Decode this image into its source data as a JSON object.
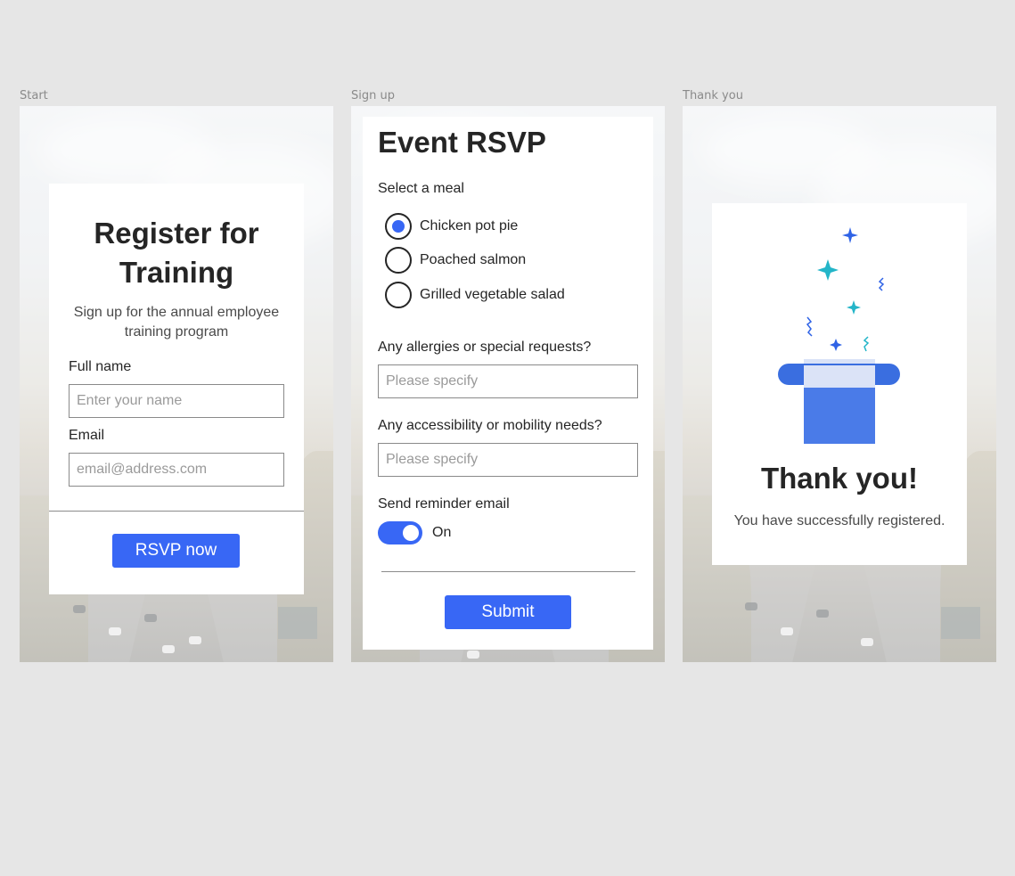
{
  "frames": {
    "start": {
      "label": "Start",
      "title": "Register for Training",
      "subtitle": "Sign up for the annual employee training program",
      "full_name_label": "Full name",
      "full_name_placeholder": "Enter your name",
      "email_label": "Email",
      "email_placeholder": "email@address.com",
      "rsvp_button": "RSVP now"
    },
    "signup": {
      "label": "Sign up",
      "title": "Event RSVP",
      "meal_label": "Select a meal",
      "meal_options": [
        {
          "label": "Chicken pot pie",
          "selected": true
        },
        {
          "label": "Poached salmon",
          "selected": false
        },
        {
          "label": "Grilled vegetable salad",
          "selected": false
        }
      ],
      "allergies_label": "Any allergies or special requests?",
      "allergies_placeholder": "Please specify",
      "accessibility_label": "Any accessibility or mobility needs?",
      "accessibility_placeholder": "Please specify",
      "reminder_label": "Send reminder email",
      "reminder_state": "On",
      "submit_button": "Submit"
    },
    "thankyou": {
      "label": "Thank you",
      "title": "Thank you!",
      "message": "You have successfully registered."
    }
  },
  "colors": {
    "accent": "#3867f5",
    "canvas": "#e6e6e6",
    "sparkle_teal": "#23b5c8",
    "sparkle_blue": "#2f63e6"
  },
  "icons": [
    "magic-hat-icon",
    "sparkle-icon",
    "squiggle-icon",
    "background-photo"
  ]
}
